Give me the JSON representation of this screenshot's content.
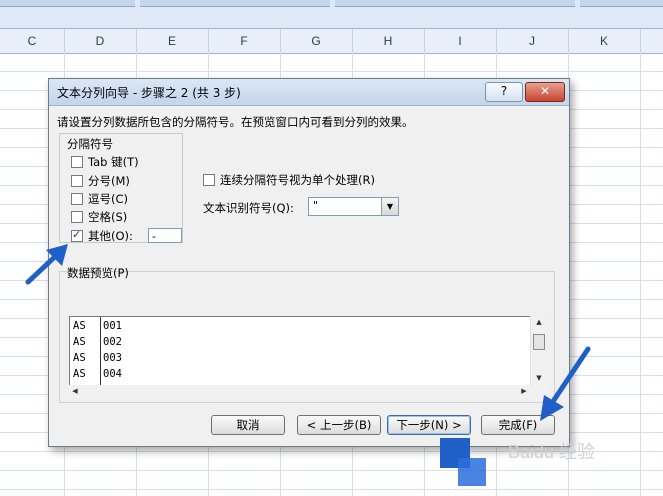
{
  "columns": [
    "C",
    "D",
    "E",
    "F",
    "G",
    "H",
    "I",
    "J",
    "K"
  ],
  "dialog": {
    "title": "文本分列向导 - 步骤之 2 (共 3 步)",
    "help_label": "?",
    "close_label": "✕",
    "instruction": "请设置分列数据所包含的分隔符号。在预览窗口内可看到分列的效果。",
    "delimiters": {
      "legend": "分隔符号",
      "items": [
        {
          "label": "Tab 键(T)",
          "checked": false
        },
        {
          "label": "分号(M)",
          "checked": false
        },
        {
          "label": "逗号(C)",
          "checked": false
        },
        {
          "label": "空格(S)",
          "checked": false
        },
        {
          "label": "其他(O):",
          "checked": true
        }
      ],
      "other_value": "-"
    },
    "consecutive_label": "连续分隔符号视为单个处理(R)",
    "consecutive_checked": false,
    "text_qualifier_label": "文本识别符号(Q):",
    "text_qualifier_value": "\"",
    "preview_title": "数据预览(P)",
    "preview_rows": [
      [
        "AS",
        "001"
      ],
      [
        "AS",
        "002"
      ],
      [
        "AS",
        "003"
      ],
      [
        "AS",
        "004"
      ]
    ],
    "buttons": {
      "cancel": "取消",
      "back": "< 上一步(B)",
      "next": "下一步(N) >",
      "finish": "完成(F)"
    }
  },
  "watermark": "Baidu 经验",
  "accent_color": "#1f5fc7"
}
